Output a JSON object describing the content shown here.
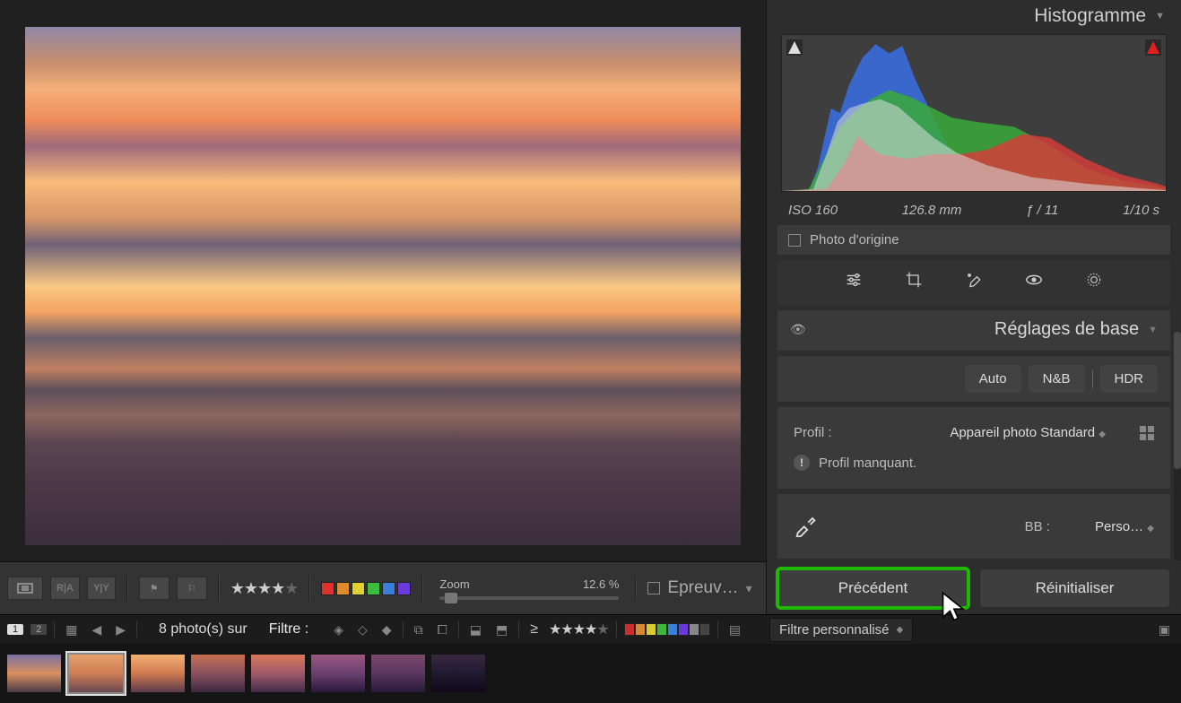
{
  "rightPanel": {
    "histogram": {
      "title": "Histogramme"
    },
    "exif": {
      "iso": "ISO 160",
      "focal": "126.8 mm",
      "aperture": "ƒ / 11",
      "shutter": "1/10 s"
    },
    "originalLabel": "Photo d'origine",
    "basic": {
      "title": "Réglages de base",
      "auto": "Auto",
      "bw": "N&B",
      "hdr": "HDR",
      "profileLabel": "Profil :",
      "profileValue": "Appareil photo Standard",
      "profileWarning": "Profil manquant.",
      "wbLabel": "BB :",
      "wbValue": "Perso…"
    },
    "actions": {
      "previous": "Précédent",
      "reset": "Réinitialiser"
    }
  },
  "toolbar": {
    "viewBtn1": "R|A",
    "viewBtn2": "Y|Y",
    "ratingStars": 4,
    "zoomLabel": "Zoom",
    "zoomValue": "12.6 %",
    "softProof": "Epreuv…",
    "swatches": [
      "#e03030",
      "#e08a30",
      "#e0d030",
      "#3dbb3d",
      "#3a80d8",
      "#6a3adb"
    ]
  },
  "filterBar": {
    "page1": "1",
    "page2": "2",
    "countText": "8 photo(s) sur",
    "filterLabel": "Filtre :",
    "ge": "≥",
    "ratingStars": 4,
    "filterDropdown": "Filtre personnalisé",
    "colorLabels": [
      "#c83030",
      "#d88a30",
      "#d8cc30",
      "#3db83d",
      "#3a80d8",
      "#6a3ad8",
      "#888",
      "#444"
    ]
  },
  "filmstrip": {
    "thumbs": [
      "linear-gradient(180deg,#7a6fa2 0%,#d88f5f 50%,#4a3a48 100%)",
      "linear-gradient(180deg,#e5a06a 0%,#ce7c54 50%,#6a4850 100%)",
      "linear-gradient(180deg,#f0b070 0%,#d17a52 50%,#5a3a48 100%)",
      "linear-gradient(180deg,#c87050 0%,#8a5060 50%,#3a2840 100%)",
      "linear-gradient(180deg,#d87858 0%,#a05a6a 50%,#402a48 100%)",
      "linear-gradient(180deg,#9a5880 0%,#6a4070 50%,#2a1838 100%)",
      "linear-gradient(180deg,#7a486a 0%,#5a3660 50%,#281a38 100%)",
      "linear-gradient(180deg,#382840 0%,#201a30 50%,#100818 100%)"
    ],
    "selectedIndex": 1
  }
}
